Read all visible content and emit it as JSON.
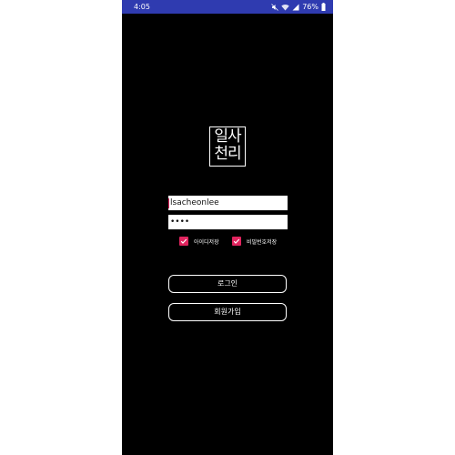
{
  "status_bar": {
    "time": "4:05",
    "battery_percent": "76%",
    "icons": [
      "mute-icon",
      "wifi-icon",
      "signal-icon",
      "battery-icon"
    ]
  },
  "logo": {
    "line1": "일사",
    "line2": "천리"
  },
  "login_form": {
    "id_value": "lsacheonlee",
    "password_value": "••••",
    "save_id_label": "아이디저장",
    "save_id_checked": true,
    "save_password_label": "비밀번호저장",
    "save_password_checked": true
  },
  "buttons": {
    "login_label": "로그인",
    "signup_label": "회원가입"
  },
  "colors": {
    "status_bar": "#2f3bb0",
    "background": "#000000",
    "accent": "#e0245e"
  }
}
